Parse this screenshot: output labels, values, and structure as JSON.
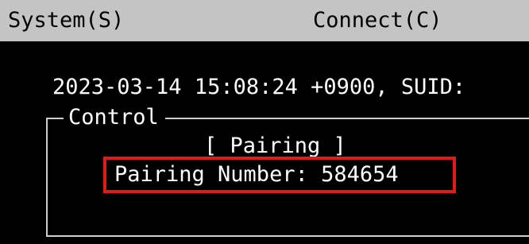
{
  "menubar": {
    "system_label": "System(S)",
    "connect_label": "Connect(C)"
  },
  "status": {
    "text": "2023-03-14 15:08:24 +0900, SUID:"
  },
  "control": {
    "legend": "Control",
    "heading": "[ Pairing ]",
    "pairing_number_text": "Pairing Number: 584654"
  },
  "colors": {
    "background": "#000000",
    "menubar": "#c4c4c4",
    "text": "#ffffff",
    "highlight_box": "#e11a1a"
  }
}
